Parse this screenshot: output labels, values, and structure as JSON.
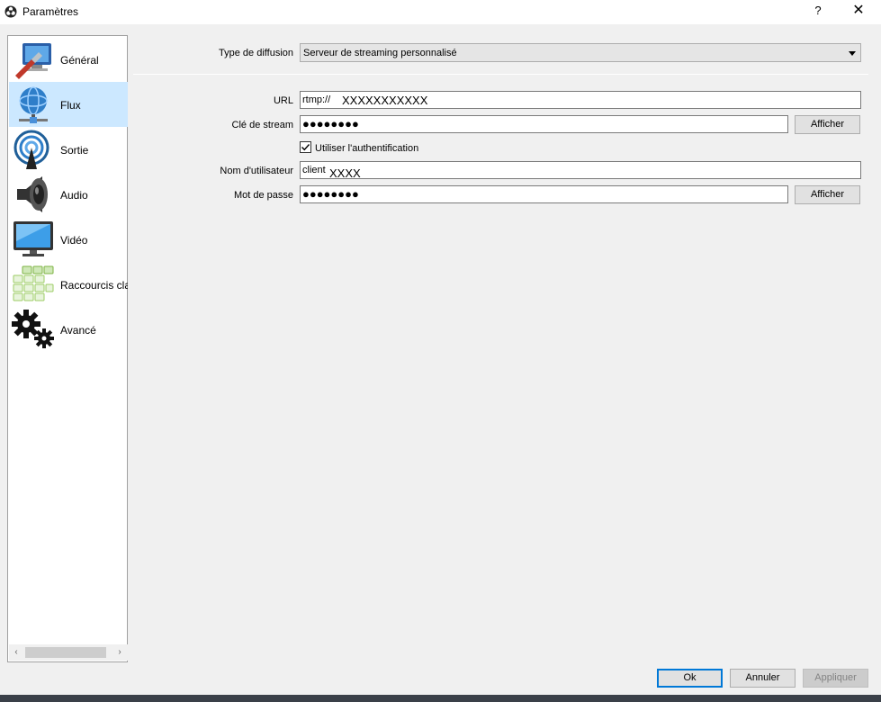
{
  "window": {
    "title": "Paramètres",
    "help_glyph": "?",
    "close_glyph": "✕"
  },
  "sidebar": {
    "items": [
      {
        "label": "Général",
        "icon": "general-settings-icon"
      },
      {
        "label": "Flux",
        "icon": "stream-globe-icon"
      },
      {
        "label": "Sortie",
        "icon": "output-broadcast-icon"
      },
      {
        "label": "Audio",
        "icon": "speaker-icon"
      },
      {
        "label": "Vidéo",
        "icon": "monitor-icon"
      },
      {
        "label": "Raccourcis clavier",
        "icon": "hotkeys-keyboard-icon"
      },
      {
        "label": "Avancé",
        "icon": "gears-icon"
      }
    ],
    "selected_index": 1,
    "scroll_left": "‹",
    "scroll_right": "›"
  },
  "stream": {
    "type_label": "Type de diffusion",
    "type_value": "Serveur de streaming personnalisé",
    "url_label": "URL",
    "url_value": "rtmp://",
    "url_overlay": "XXXXXXXXXXX",
    "key_label": "Clé de stream",
    "key_value": "●●●●●●●●",
    "key_show": "Afficher",
    "auth_label": "Utiliser l'authentification",
    "auth_checked": true,
    "user_label": "Nom d'utilisateur",
    "user_value": "client",
    "user_overlay": "XXXX",
    "pass_label": "Mot de passe",
    "pass_value": "●●●●●●●●",
    "pass_show": "Afficher"
  },
  "footer": {
    "ok": "Ok",
    "cancel": "Annuler",
    "apply": "Appliquer"
  },
  "colors": {
    "selected_bg": "#cce8ff",
    "accent": "#0078d7"
  }
}
